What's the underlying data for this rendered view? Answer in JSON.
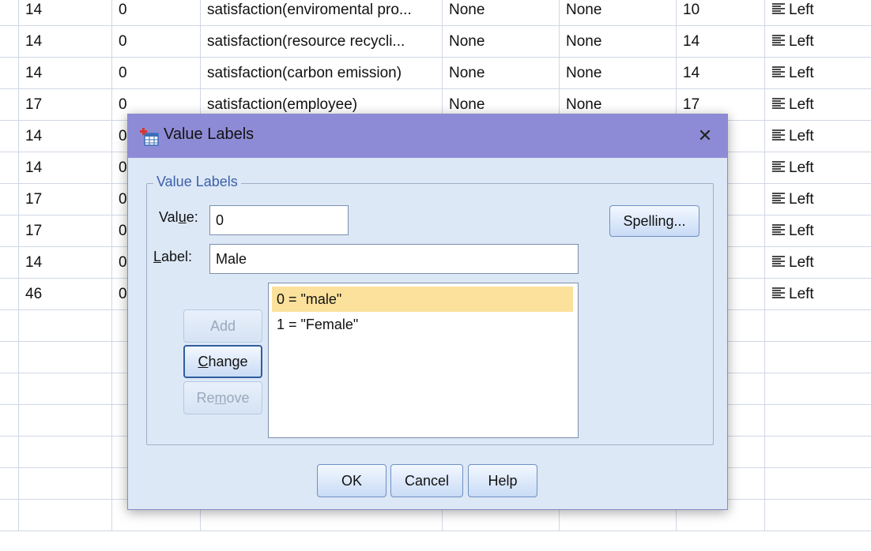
{
  "grid": {
    "rows": [
      {
        "width": "14",
        "decimals": "0",
        "label": "satisfaction(enviromental pro...",
        "values": "None",
        "missing": "None",
        "columns": "10",
        "align": "Left"
      },
      {
        "width": "14",
        "decimals": "0",
        "label": "satisfaction(resource recycli...",
        "values": "None",
        "missing": "None",
        "columns": "14",
        "align": "Left"
      },
      {
        "width": "14",
        "decimals": "0",
        "label": "satisfaction(carbon emission)",
        "values": "None",
        "missing": "None",
        "columns": "14",
        "align": "Left"
      },
      {
        "width": "17",
        "decimals": "0",
        "label": "satisfaction(employee)",
        "values": "None",
        "missing": "None",
        "columns": "17",
        "align": "Left"
      },
      {
        "width": "14",
        "decimals": "0",
        "label": "",
        "values": "",
        "missing": "",
        "columns": "",
        "align": "Left"
      },
      {
        "width": "14",
        "decimals": "0",
        "label": "",
        "values": "",
        "missing": "",
        "columns": "",
        "align": "Left"
      },
      {
        "width": "17",
        "decimals": "0",
        "label": "",
        "values": "",
        "missing": "",
        "columns": "",
        "align": "Left"
      },
      {
        "width": "17",
        "decimals": "0",
        "label": "",
        "values": "",
        "missing": "",
        "columns": "",
        "align": "Left"
      },
      {
        "width": "14",
        "decimals": "0",
        "label": "",
        "values": "",
        "missing": "",
        "columns": "",
        "align": "Left"
      },
      {
        "width": "46",
        "decimals": "0",
        "label": "",
        "values": "",
        "missing": "",
        "columns": "",
        "align": "Left"
      },
      {
        "width": "",
        "decimals": "",
        "label": "",
        "values": "",
        "missing": "",
        "columns": "",
        "align": ""
      },
      {
        "width": "",
        "decimals": "",
        "label": "",
        "values": "",
        "missing": "",
        "columns": "",
        "align": ""
      },
      {
        "width": "",
        "decimals": "",
        "label": "",
        "values": "",
        "missing": "",
        "columns": "",
        "align": ""
      },
      {
        "width": "",
        "decimals": "",
        "label": "",
        "values": "",
        "missing": "",
        "columns": "",
        "align": ""
      },
      {
        "width": "",
        "decimals": "",
        "label": "",
        "values": "",
        "missing": "",
        "columns": "",
        "align": ""
      },
      {
        "width": "",
        "decimals": "",
        "label": "",
        "values": "",
        "missing": "",
        "columns": "",
        "align": ""
      },
      {
        "width": "",
        "decimals": "",
        "label": "",
        "values": "",
        "missing": "",
        "columns": "",
        "align": ""
      }
    ]
  },
  "dialog": {
    "title": "Value Labels",
    "close_glyph": "✕",
    "group_title": "Value Labels",
    "value_label_prefix": "Val",
    "value_label_mnemonic": "u",
    "value_label_suffix": "e:",
    "label_label_mnemonic": "L",
    "label_label_suffix": "abel:",
    "value_input": "0",
    "label_input": "Male",
    "buttons": {
      "spelling": "Spelling...",
      "add": "Add",
      "change_mnemonic": "C",
      "change_rest": "hange",
      "remove_prefix": "Re",
      "remove_mnemonic": "m",
      "remove_rest": "ove",
      "ok": "OK",
      "cancel": "Cancel",
      "help": "Help"
    },
    "list_items": [
      {
        "text": "0 = \"male\"",
        "selected": true
      },
      {
        "text": "1 = \"Female\"",
        "selected": false
      }
    ]
  },
  "colors": {
    "titlebar": "#8e8bd6",
    "dialog_bg": "#dde8f6",
    "selected_item": "#fbe19b",
    "group_title": "#3b5fa8"
  }
}
